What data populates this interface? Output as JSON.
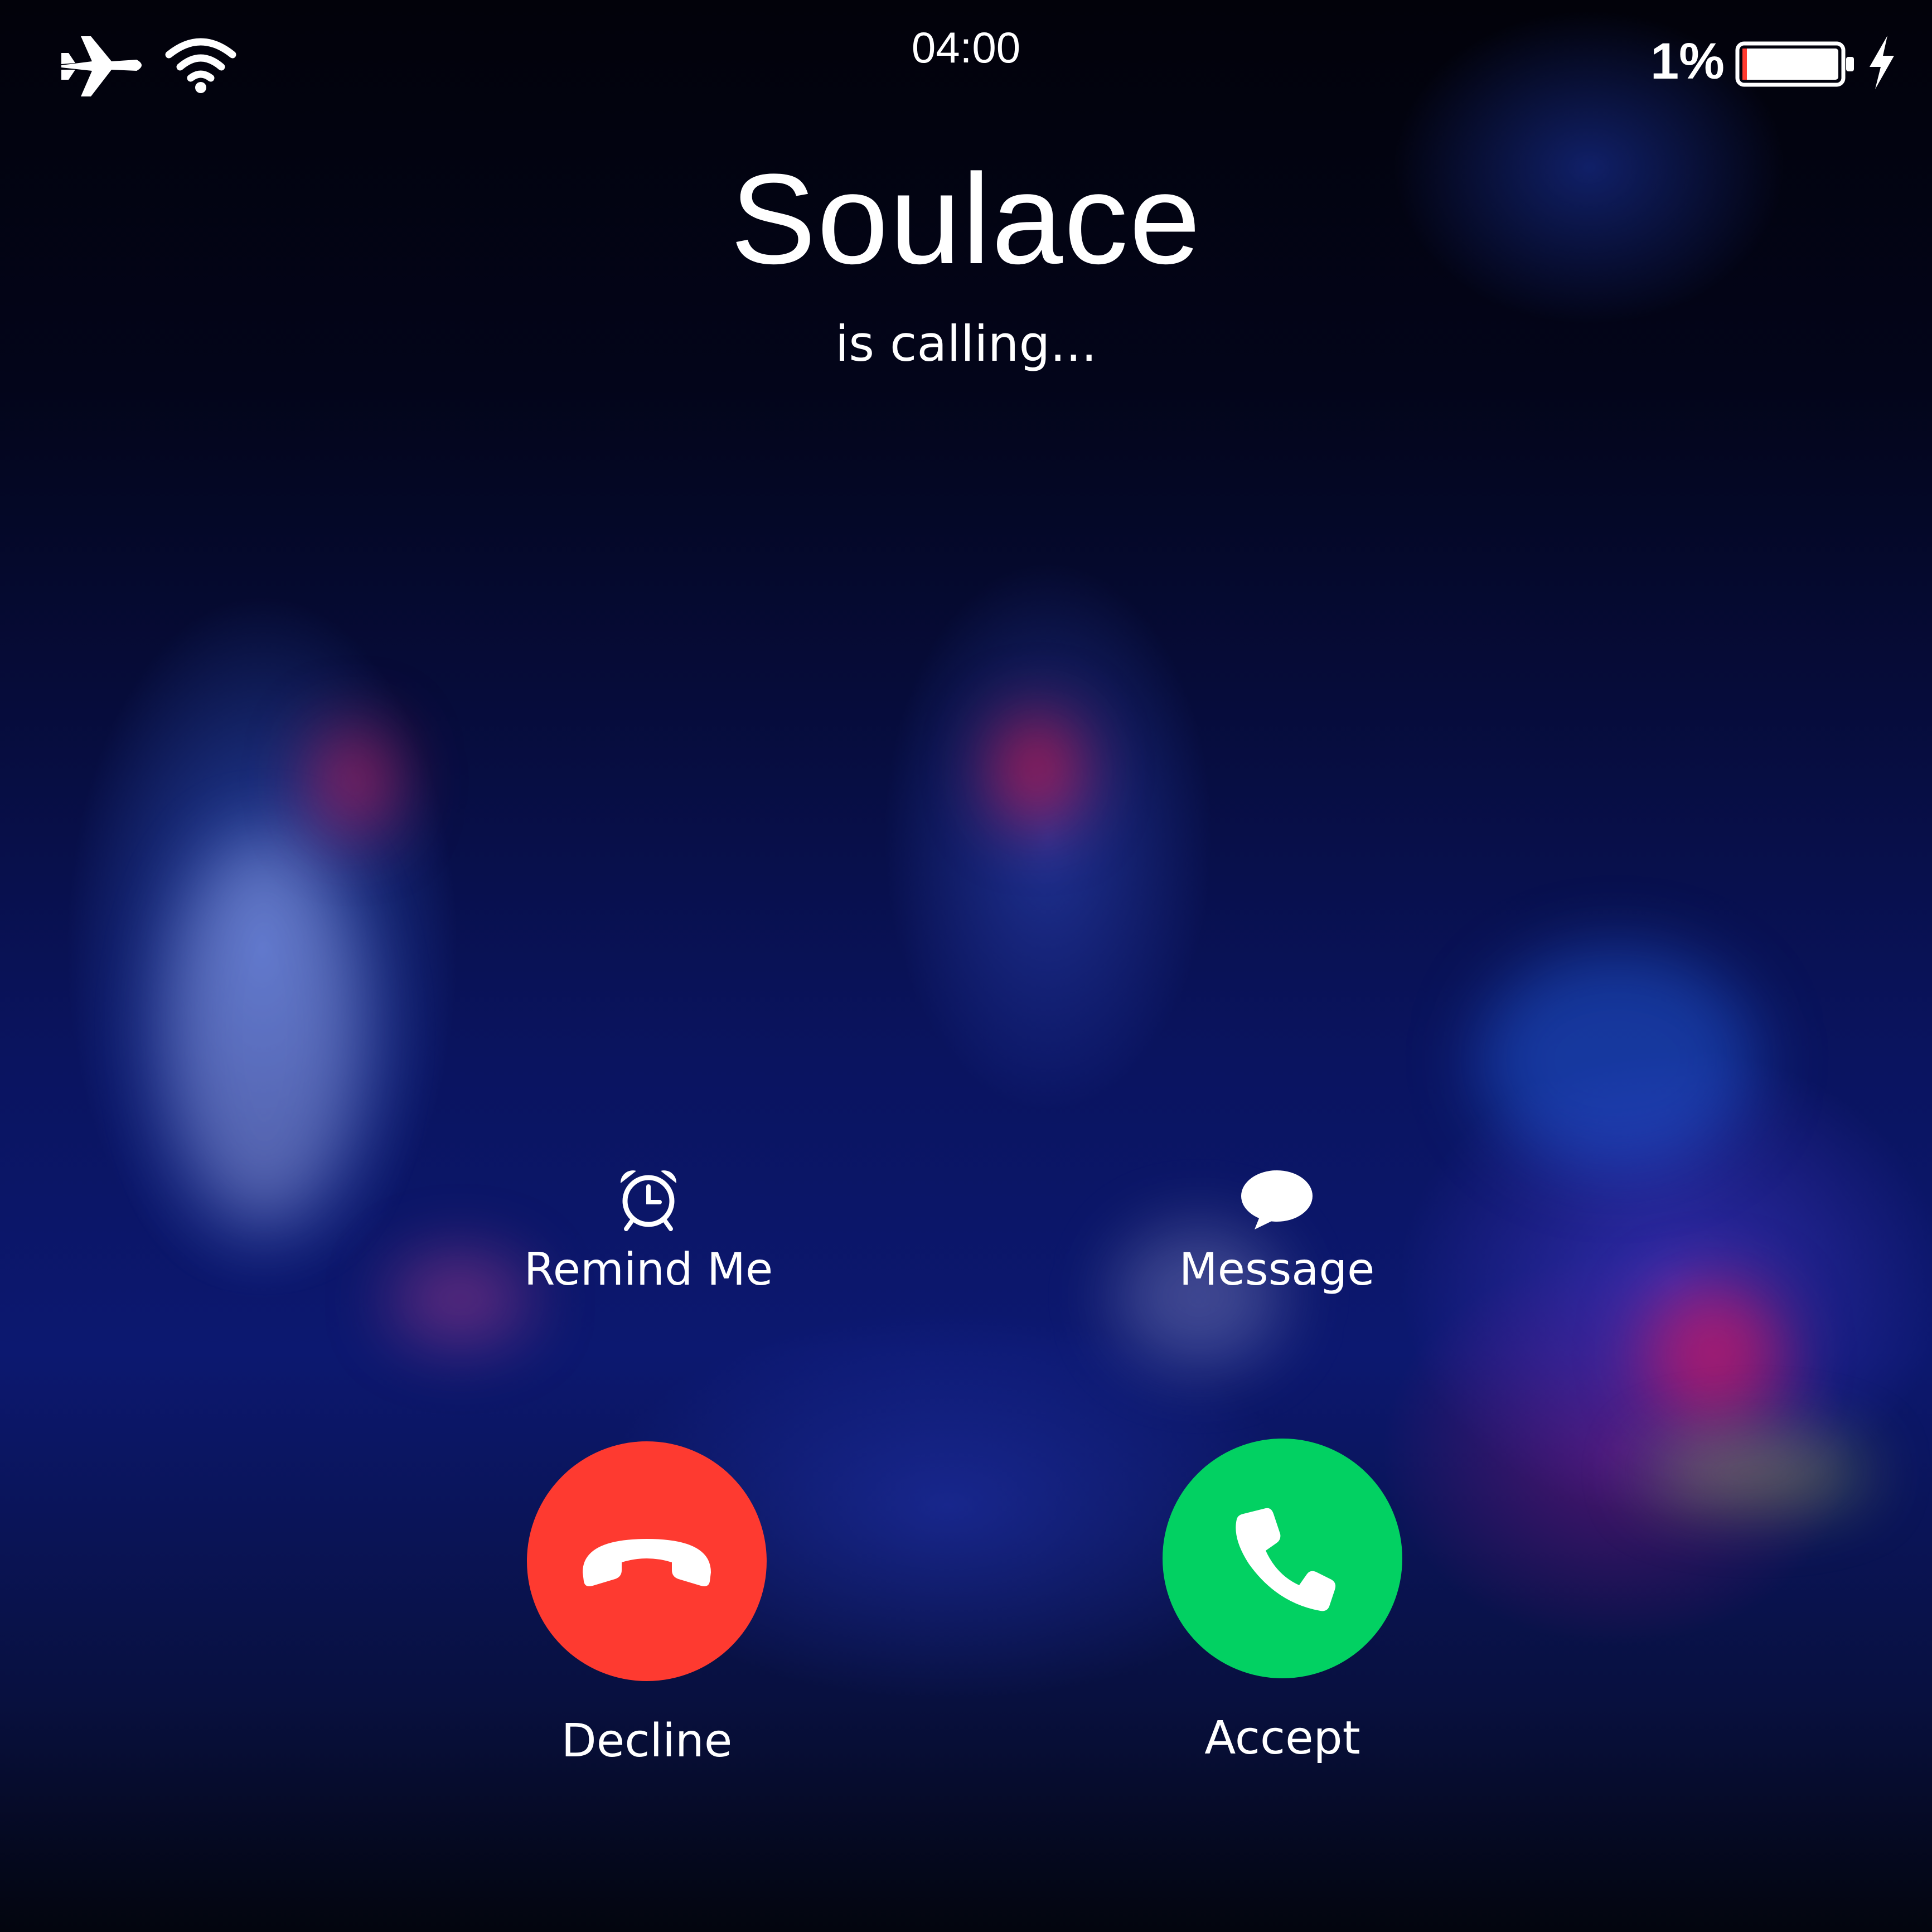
{
  "status_bar": {
    "time": "04:00",
    "battery_percent": "1%",
    "icons": [
      "airplane-icon",
      "wifi-icon",
      "battery-icon",
      "charging-bolt-icon"
    ]
  },
  "call": {
    "caller_name": "Soulace",
    "status": "is calling..."
  },
  "actions": {
    "remind_label": "Remind Me",
    "remind_icon": "alarm-clock-icon",
    "message_label": "Message",
    "message_icon": "speech-bubble-icon"
  },
  "buttons": {
    "decline_label": "Decline",
    "decline_color": "#fe3a30",
    "accept_label": "Accept",
    "accept_color": "#02d162"
  }
}
